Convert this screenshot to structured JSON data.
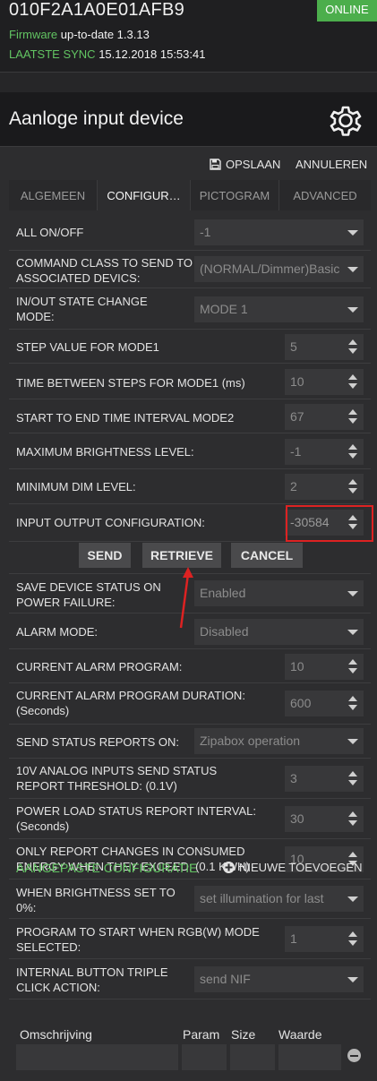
{
  "device": {
    "id": "010F2A1A0E01AFB9",
    "status": "ONLINE",
    "firmware_label": "Firmware",
    "firmware_value": "up-to-date 1.3.13",
    "sync_label": "LAATSTE SYNC",
    "sync_value": "15.12.2018 15:53:41"
  },
  "header": {
    "title": "Aanloge input device",
    "settings_icon": "gear-icon"
  },
  "actions": {
    "save": "OPSLAAN",
    "cancel": "ANNULEREN"
  },
  "tabs": [
    "ALGEMEEN",
    "CONFIGUR…",
    "PICTOGRAM",
    "ADVANCED"
  ],
  "params": [
    {
      "label": "ALL ON/OFF",
      "value": "-1"
    },
    {
      "label": "COMMAND CLASS TO SEND TO ASSOCIATED DEVICS:",
      "value": "(NORMAL/Dimmer)Basic"
    },
    {
      "label": "IN/OUT STATE CHANGE MODE:",
      "value": "MODE 1"
    },
    {
      "label": "STEP VALUE FOR MODE1",
      "value": "5"
    },
    {
      "label": "TIME BETWEEN STEPS FOR MODE1",
      "unit": "(ms)",
      "value": "10"
    },
    {
      "label": "START TO END TIME INTERVAL MODE2",
      "value": "67"
    },
    {
      "label": "MAXIMUM BRIGHTNESS LEVEL:",
      "value": "-1"
    },
    {
      "label": "MINIMUM DIM LEVEL:",
      "value": "2"
    },
    {
      "label": "INPUT OUTPUT CONFIGURATION:",
      "value": "-30584"
    },
    {
      "label": "SAVE DEVICE STATUS ON POWER FAILURE:",
      "value": "Enabled"
    },
    {
      "label": "ALARM MODE:",
      "value": "Disabled"
    },
    {
      "label": "CURRENT ALARM PROGRAM:",
      "value": "10"
    },
    {
      "label": "CURRENT ALARM PROGRAM DURATION:",
      "unit": "(Seconds)",
      "value": "600"
    },
    {
      "label": "SEND STATUS REPORTS ON:",
      "value": "Zipabox operation"
    },
    {
      "label": "10V ANALOG INPUTS SEND STATUS REPORT THRESHOLD: (0.1V)",
      "value": "3"
    },
    {
      "label": "POWER LOAD STATUS REPORT INTERVAL:",
      "unit": "(Seconds)",
      "value": "30"
    },
    {
      "label": "ONLY REPORT CHANGES IN CONSUMED ENERGY WHEN THEY EXCEED: (0.1 kWh)",
      "value": "10"
    },
    {
      "label": "WHEN BRIGHTNESS SET TO 0%:",
      "value": "set illumination for last"
    },
    {
      "label": "PROGRAM TO START WHEN RGB(W) MODE SELECTED:",
      "value": "1"
    },
    {
      "label": "INTERNAL BUTTON TRIPLE CLICK ACTION:",
      "value": "send NIF"
    }
  ],
  "row_buttons": {
    "send": "SEND",
    "retrieve": "RETRIEVE",
    "cancel": "CANCEL"
  },
  "custom": {
    "title": "AANGEPASTE CONFIGURATIE",
    "add": "NIEUWE TOEVOEGEN",
    "columns": [
      "Omschrijving",
      "Param",
      "Size",
      "Waarde"
    ]
  },
  "colors": {
    "accent_green": "#62c462",
    "online_bg": "#4cae4c",
    "highlight_red": "#dd2222"
  }
}
